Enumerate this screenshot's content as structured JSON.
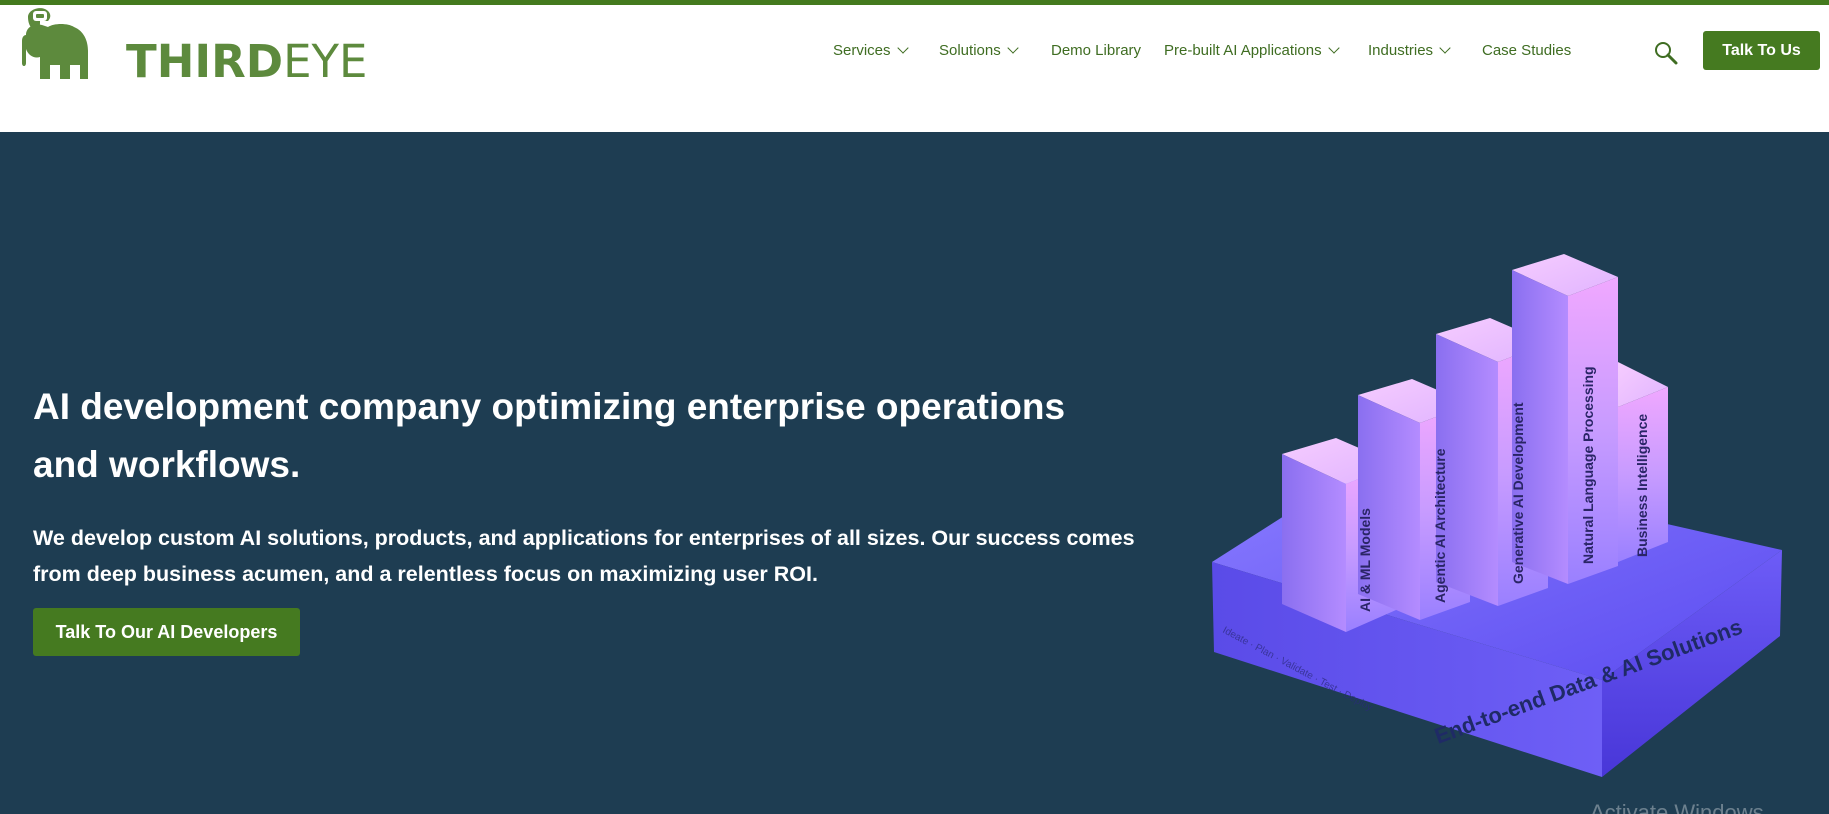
{
  "brand": {
    "name_bold": "THIRD",
    "name_light": "EYE",
    "color": "#5d8a3d",
    "accent": "#457a20",
    "hero_bg": "#1e3d52"
  },
  "nav": {
    "items": [
      {
        "label": "Services",
        "has_dropdown": true
      },
      {
        "label": "Solutions",
        "has_dropdown": true
      },
      {
        "label": "Demo Library",
        "has_dropdown": false
      },
      {
        "label": "Pre-built AI Applications",
        "has_dropdown": true
      },
      {
        "label": "Industries",
        "has_dropdown": true
      },
      {
        "label": "Case Studies",
        "has_dropdown": false
      }
    ],
    "search_icon": "search-icon",
    "cta_label": "Talk To Us"
  },
  "hero": {
    "title": "AI development company optimizing enterprise operations and workflows.",
    "description": "We develop custom AI solutions, products, and applications for enterprises of all sizes. Our success comes from deep business acumen, and a relentless focus on maximizing user ROI.",
    "cta_label": "Talk To Our AI Developers"
  },
  "illustration": {
    "base_label": "End-to-end Data & AI Solutions",
    "base_side_label": "Ideate · Plan · Validate · Test · Deploy",
    "bars": [
      {
        "label": "AI & ML Models"
      },
      {
        "label": "Agentic AI Architecture"
      },
      {
        "label": "Generative AI Development"
      },
      {
        "label": "Natural Language Processing"
      },
      {
        "label": "Business Intelligence"
      }
    ]
  },
  "watermark": "Activate Windows"
}
